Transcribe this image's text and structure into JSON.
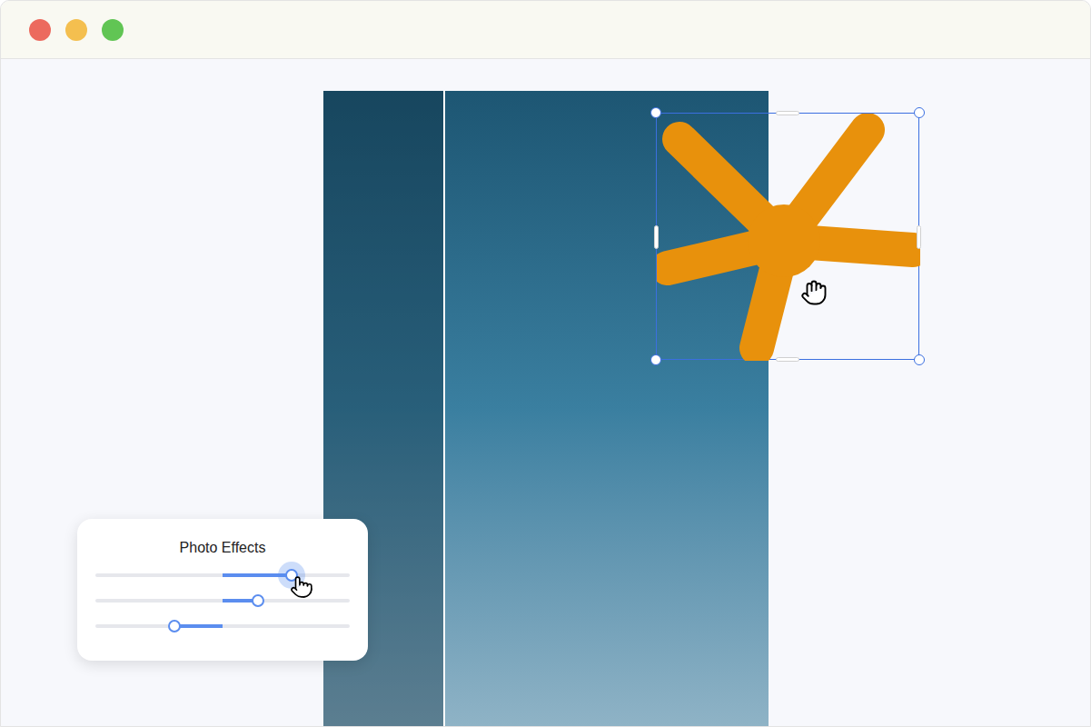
{
  "window": {
    "controls": [
      {
        "name": "close",
        "color": "#ec6a5e"
      },
      {
        "name": "minimize",
        "color": "#f4bf4f"
      },
      {
        "name": "zoom",
        "color": "#61c554"
      }
    ]
  },
  "photo": {
    "comparison_split": {
      "level": 0.27
    }
  },
  "sticker": {
    "selected": true,
    "color": "#e8910c"
  },
  "photo_effects": {
    "title": "Photo Effects",
    "sliders": [
      {
        "level": 0.77,
        "active": true
      },
      {
        "level": 0.64,
        "active": false
      },
      {
        "level": 0.31,
        "active": false
      }
    ]
  }
}
